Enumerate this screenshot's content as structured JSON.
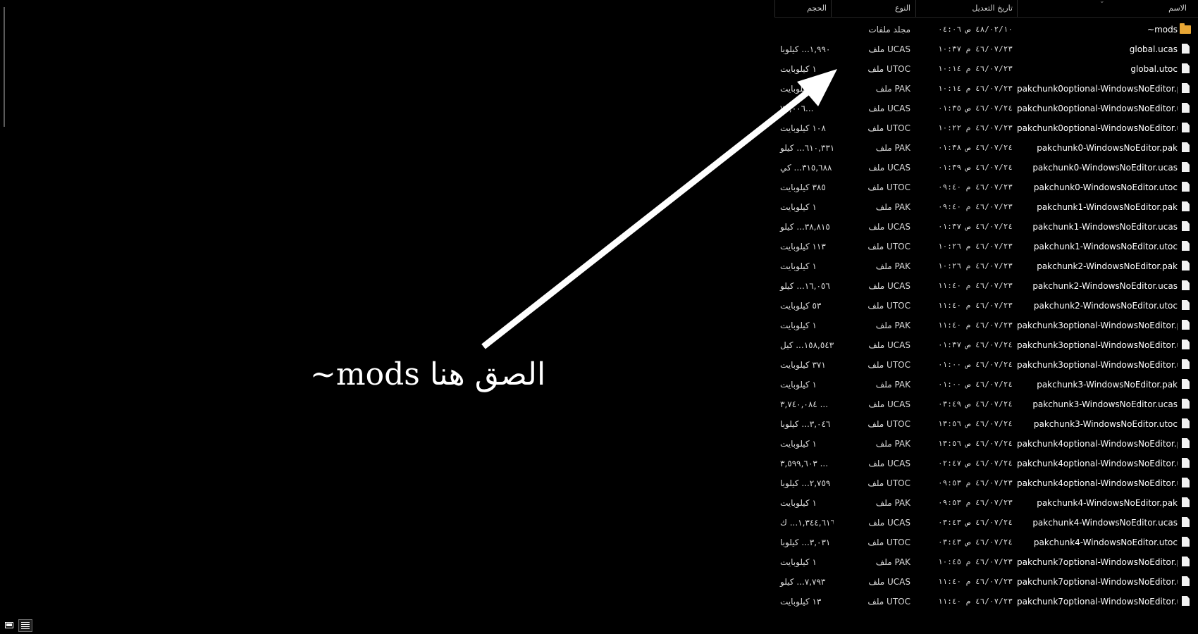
{
  "explorer": {
    "columns": {
      "name": "الاسم",
      "date_modified": "تاريخ التعديل",
      "type": "النوع",
      "size": "الحجم"
    },
    "files": [
      {
        "icon": "folder-icon",
        "name": "~mods",
        "date": "٤٨/٠٢/١٠ ص ٠٤:٠٦",
        "type": "مجلد ملفات",
        "size": ""
      },
      {
        "icon": "file-icon",
        "name": "global.ucas",
        "date": "٤٦/٠٧/٢٣ م ١٠:٣٧",
        "type": "ملف UCAS",
        "size": "١,٩٩٠... كيلوبا"
      },
      {
        "icon": "file-icon",
        "name": "global.utoc",
        "date": "٤٦/٠٧/٢٣ م ١٠:١٤",
        "type": "ملف UTOC",
        "size": "١ كيلوبايت"
      },
      {
        "icon": "file-icon",
        "name": "pakchunk0optional-WindowsNoEditor.pak",
        "date": "٤٦/٠٧/٢٣ م ١٠:١٤",
        "type": "ملف PAK",
        "size": "كيلوبايت"
      },
      {
        "icon": "file-icon",
        "name": "pakchunk0optional-WindowsNoEditor.u...",
        "date": "٤٦/٠٧/٢٤ ص ٠١:٣٥",
        "type": "ملف UCAS",
        "size": "٧٧,٠٠٦..."
      },
      {
        "icon": "file-icon",
        "name": "pakchunk0optional-WindowsNoEditor.ut...",
        "date": "٤٦/٠٧/٢٣ م ١٠:٢٢",
        "type": "ملف UTOC",
        "size": "١٠٨ كيلوبايت"
      },
      {
        "icon": "file-icon",
        "name": "pakchunk0-WindowsNoEditor.pak",
        "date": "٤٦/٠٧/٢٤ ص ٠١:٣٨",
        "type": "ملف PAK",
        "size": "٦١٠,٣٣١... كيلو"
      },
      {
        "icon": "file-icon",
        "name": "pakchunk0-WindowsNoEditor.ucas",
        "date": "٤٦/٠٧/٢٤ ص ٠١:٣٩",
        "type": "ملف UCAS",
        "size": "٣١٥,٦٨٨... كي"
      },
      {
        "icon": "file-icon",
        "name": "pakchunk0-WindowsNoEditor.utoc",
        "date": "٤٦/٠٧/٢٣ م ٠٩:٤٠",
        "type": "ملف UTOC",
        "size": "٣٨٥ كيلوبايت"
      },
      {
        "icon": "file-icon",
        "name": "pakchunk1-WindowsNoEditor.pak",
        "date": "٤٦/٠٧/٢٣ م ٠٩:٤٠",
        "type": "ملف PAK",
        "size": "١ كيلوبايت"
      },
      {
        "icon": "file-icon",
        "name": "pakchunk1-WindowsNoEditor.ucas",
        "date": "٤٦/٠٧/٢٤ ص ٠١:٣٧",
        "type": "ملف UCAS",
        "size": "٣٨,٨١٥... كيلو"
      },
      {
        "icon": "file-icon",
        "name": "pakchunk1-WindowsNoEditor.utoc",
        "date": "٤٦/٠٧/٢٣ م ١٠:٢٦",
        "type": "ملف UTOC",
        "size": "١١٣ كيلوبايت"
      },
      {
        "icon": "file-icon",
        "name": "pakchunk2-WindowsNoEditor.pak",
        "date": "٤٦/٠٧/٢٣ م ١٠:٢٦",
        "type": "ملف PAK",
        "size": "١ كيلوبايت"
      },
      {
        "icon": "file-icon",
        "name": "pakchunk2-WindowsNoEditor.ucas",
        "date": "٤٦/٠٧/٢٣ م ١١:٤٠",
        "type": "ملف UCAS",
        "size": "١٦,٠٥٦... كيلو"
      },
      {
        "icon": "file-icon",
        "name": "pakchunk2-WindowsNoEditor.utoc",
        "date": "٤٦/٠٧/٢٣ م ١١:٤٠",
        "type": "ملف UTOC",
        "size": "٥٣ كيلوبايت"
      },
      {
        "icon": "file-icon",
        "name": "pakchunk3optional-WindowsNoEditor.pak",
        "date": "٤٦/٠٧/٢٣ م ١١:٤٠",
        "type": "ملف PAK",
        "size": "١ كيلوبايت"
      },
      {
        "icon": "file-icon",
        "name": "pakchunk3optional-WindowsNoEditor.u...",
        "date": "٤٦/٠٧/٢٤ ص ٠١:٣٧",
        "type": "ملف UCAS",
        "size": "١٥٨,٥٤٣... كيل"
      },
      {
        "icon": "file-icon",
        "name": "pakchunk3optional-WindowsNoEditor.ut...",
        "date": "٤٦/٠٧/٢٤ ص ٠١:٠٠",
        "type": "ملف UTOC",
        "size": "٣٧١ كيلوبايت"
      },
      {
        "icon": "file-icon",
        "name": "pakchunk3-WindowsNoEditor.pak",
        "date": "٤٦/٠٧/٢٤ ص ٠١:٠٠",
        "type": "ملف PAK",
        "size": "١ كيلوبايت"
      },
      {
        "icon": "file-icon",
        "name": "pakchunk3-WindowsNoEditor.ucas",
        "date": "٤٦/٠٧/٢٤ ص ٠٣:٤٩",
        "type": "ملف UCAS",
        "size": "٣,٧٤٠,٠٨٤ ..."
      },
      {
        "icon": "file-icon",
        "name": "pakchunk3-WindowsNoEditor.utoc",
        "date": "٤٦/٠٧/٢٤ ص ١٣:٥٦",
        "type": "ملف UTOC",
        "size": "٣,٠٤٦... كيلوبا"
      },
      {
        "icon": "file-icon",
        "name": "pakchunk4optional-WindowsNoEditor.pak",
        "date": "٤٦/٠٧/٢٤ ص ١٣:٥٦",
        "type": "ملف PAK",
        "size": "١ كيلوبايت"
      },
      {
        "icon": "file-icon",
        "name": "pakchunk4optional-WindowsNoEditor.u...",
        "date": "٤٦/٠٧/٢٤ ص ٠٢:٤٧",
        "type": "ملف UCAS",
        "size": "٣,٥٩٩,٦٠٣ ..."
      },
      {
        "icon": "file-icon",
        "name": "pakchunk4optional-WindowsNoEditor.ut...",
        "date": "٤٦/٠٧/٢٣ م ٠٩:٥٣",
        "type": "ملف UTOC",
        "size": "٢,٧٥٩... كيلوبا"
      },
      {
        "icon": "file-icon",
        "name": "pakchunk4-WindowsNoEditor.pak",
        "date": "٤٦/٠٧/٢٣ م ٠٩:٥٣",
        "type": "ملف PAK",
        "size": "١ كيلوبايت"
      },
      {
        "icon": "file-icon",
        "name": "pakchunk4-WindowsNoEditor.ucas",
        "date": "٤٦/٠٧/٢٤ ص ٠٣:٤٣",
        "type": "ملف UCAS",
        "size": "١,٣٤٤,٦١٦... ك"
      },
      {
        "icon": "file-icon",
        "name": "pakchunk4-WindowsNoEditor.utoc",
        "date": "٤٦/٠٧/٢٤ ص ٠٣:٤٣",
        "type": "ملف UTOC",
        "size": "٣,٠٣١... كيلوبا"
      },
      {
        "icon": "file-icon",
        "name": "pakchunk7optional-WindowsNoEditor.pak",
        "date": "٤٦/٠٧/٢٣ م ١٠:٤٥",
        "type": "ملف PAK",
        "size": "١ كيلوبايت"
      },
      {
        "icon": "file-icon",
        "name": "pakchunk7optional-WindowsNoEditor.ucas",
        "date": "٤٦/٠٧/٢٣ م ١١:٤٠",
        "type": "ملف UCAS",
        "size": "٧,٧٩٣... كيلو"
      },
      {
        "icon": "file-icon",
        "name": "pakchunk7optional-WindowsNoEditor.ut...",
        "date": "٤٦/٠٧/٢٣ م ١١:٤٠",
        "type": "ملف UTOC",
        "size": "١٣ كيلوبايت"
      }
    ]
  },
  "annotation": {
    "text": "الصق هنا mods~"
  },
  "colors": {
    "background": "#000000",
    "text": "#ffffff",
    "folder": "#e8a735"
  }
}
